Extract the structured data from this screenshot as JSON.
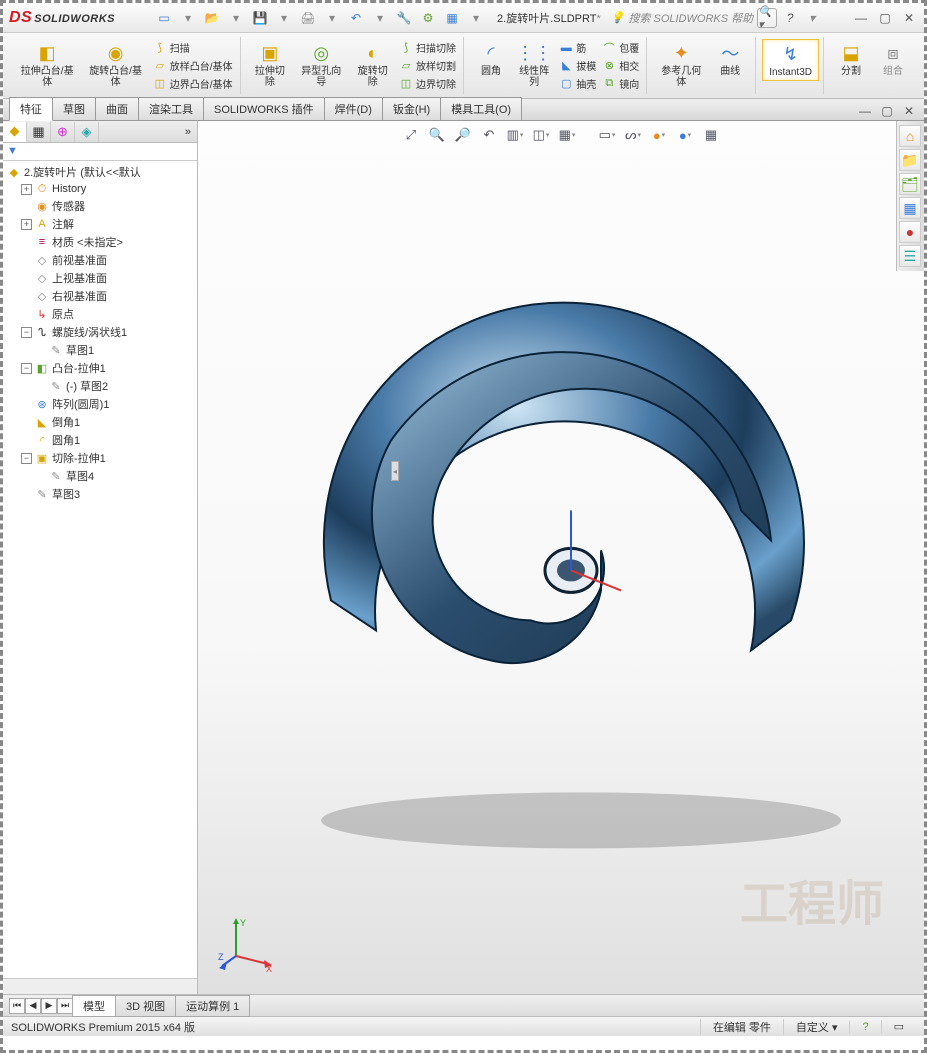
{
  "app": {
    "name": "SOLIDWORKS",
    "filename": "2.旋转叶片.SLDPRT",
    "modified": "*"
  },
  "search": {
    "placeholder": "搜索 SOLIDWORKS 帮助"
  },
  "ribbon": {
    "extrude_boss": "拉伸凸台/基体",
    "revolve_boss": "旋转凸台/基体",
    "sweep": "扫描",
    "loft_boss": "放样凸台/基体",
    "boundary_boss": "边界凸台/基体",
    "extrude_cut": "拉伸切除",
    "hole_wizard": "异型孔向导",
    "revolve_cut": "旋转切除",
    "sweep_cut": "扫描切除",
    "loft_cut": "放样切割",
    "boundary_cut": "边界切除",
    "fillet": "圆角",
    "linear_pattern": "线性阵列",
    "rib": "筋",
    "draft": "拔模",
    "shell": "抽壳",
    "wrap": "包覆",
    "intersect": "相交",
    "mirror": "镜向",
    "ref_geom": "参考几何体",
    "curves": "曲线",
    "instant3d": "Instant3D",
    "split": "分割",
    "combine": "组合"
  },
  "tabs": [
    "特征",
    "草图",
    "曲面",
    "渲染工具",
    "SOLIDWORKS 插件",
    "焊件(D)",
    "钣金(H)",
    "模具工具(O)"
  ],
  "tree": {
    "root": "2.旋转叶片  (默认<<默认",
    "history": "History",
    "sensors": "传感器",
    "annotations": "注解",
    "material": "材质 <未指定>",
    "front": "前视基准面",
    "top": "上视基准面",
    "right": "右视基准面",
    "origin": "原点",
    "helix": "螺旋线/涡状线1",
    "sketch1": "草图1",
    "boss_extrude": "凸台-拉伸1",
    "sketch2": "(-) 草图2",
    "circ_pattern": "阵列(圆周)1",
    "chamfer": "倒角1",
    "fillet_item": "圆角1",
    "cut_extrude": "切除-拉伸1",
    "sketch4": "草图4",
    "sketch3": "草图3"
  },
  "bottom_tabs": [
    "模型",
    "3D 视图",
    "运动算例 1"
  ],
  "status": {
    "version": "SOLIDWORKS Premium 2015 x64 版",
    "editing": "在编辑 零件",
    "custom": "自定义"
  },
  "watermark": "工程师",
  "triad": {
    "x": "X",
    "y": "Y",
    "z": "Z"
  }
}
